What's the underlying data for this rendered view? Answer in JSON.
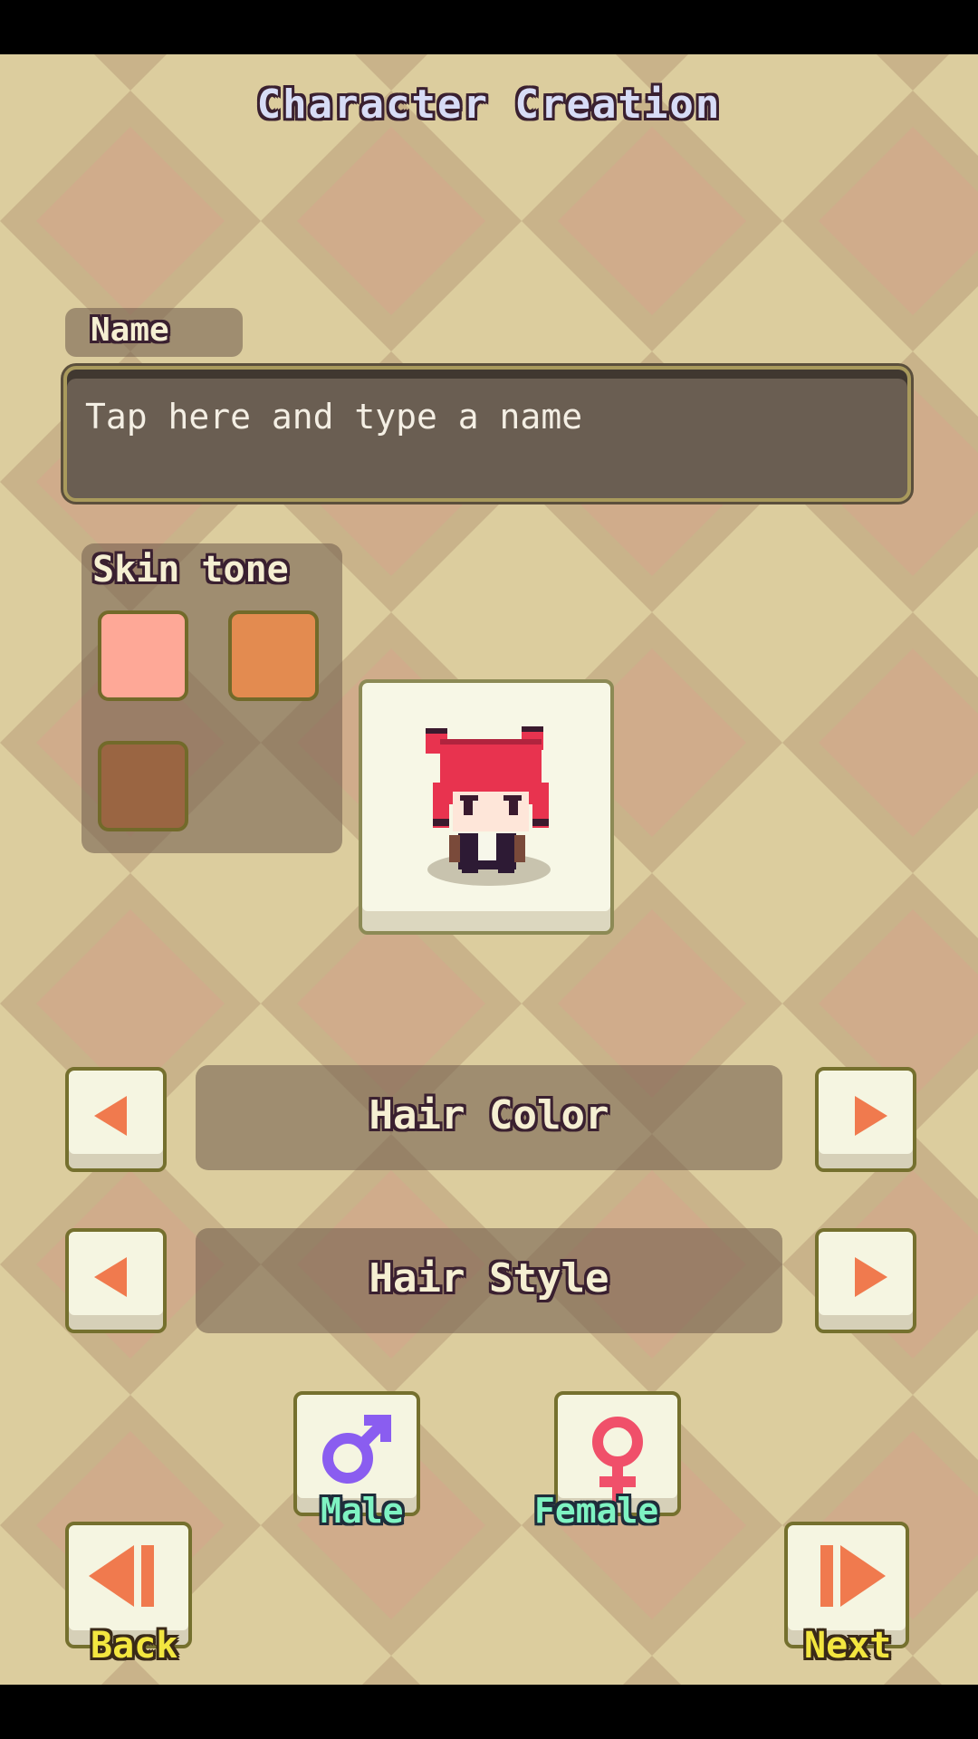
{
  "screen_title": "Character Creation",
  "name_section": {
    "label": "Name",
    "placeholder": "Tap here and type a name"
  },
  "skin_tone": {
    "label": "Skin tone",
    "options": [
      {
        "color": "#fea897"
      },
      {
        "color": "#e38b50"
      },
      {
        "color": "#9a6542"
      }
    ]
  },
  "hair_color": {
    "label": "Hair Color"
  },
  "hair_style": {
    "label": "Hair Style"
  },
  "gender": {
    "male_label": "Male",
    "female_label": "Female",
    "male_icon": "male-symbol-icon",
    "female_icon": "female-symbol-icon",
    "male_color": "#8a5df0",
    "female_color": "#f0506a"
  },
  "nav": {
    "back_label": "Back",
    "next_label": "Next"
  },
  "colors": {
    "arrow": "#f07a4e",
    "hair": "#e8334f"
  }
}
